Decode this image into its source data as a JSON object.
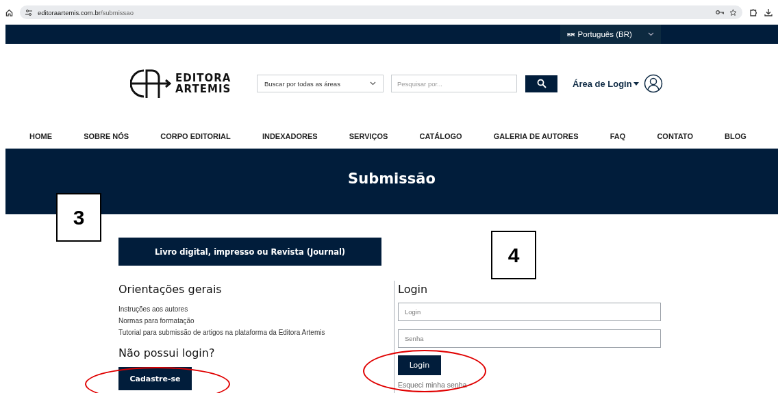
{
  "browser": {
    "url_domain": "editoraartemis.com.br",
    "url_path": "/submissao"
  },
  "language": {
    "flag": "BR",
    "label": "Português (BR)"
  },
  "header": {
    "logo_line_1": "EDITORA",
    "logo_line_2": "ARTEMIS",
    "area_select": "Buscar por todas as áreas",
    "search": {
      "placeholder": "Pesquisar por..."
    },
    "login_menu": "Área de Login"
  },
  "nav": [
    "HOME",
    "SOBRE NÓS",
    "CORPO EDITORIAL",
    "INDEXADORES",
    "SERVIÇOS",
    "CATÁLOGO",
    "GALERIA DE AUTORES",
    "FAQ",
    "CONTATO",
    "BLOG"
  ],
  "hero": {
    "title": "Submissão"
  },
  "type_button": "Livro digital, impresso ou Revista (Journal)",
  "guidelines": {
    "title": "Orientações gerais",
    "links": [
      "Instruções aos autores",
      "Normas para formatação",
      "Tutorial para submissão de artigos na plataforma da Editora Artemis"
    ]
  },
  "register": {
    "title": "Não possui login?",
    "button": "Cadastre-se"
  },
  "login": {
    "title": "Login",
    "login_field": {
      "placeholder": "Login"
    },
    "password_field": {
      "placeholder": "Senha"
    },
    "button": "Login",
    "forgot": "Esqueci minha senha"
  },
  "annotations": [
    {
      "label": "3",
      "kind": "box"
    },
    {
      "label": "4",
      "kind": "box"
    },
    {
      "kind": "ellipse"
    },
    {
      "kind": "ellipse"
    }
  ]
}
